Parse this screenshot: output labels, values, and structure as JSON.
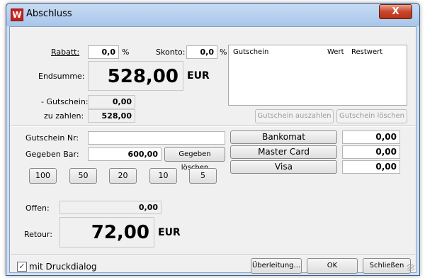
{
  "window": {
    "title": "Abschluss",
    "app_icon": "W",
    "close_glyph": "X"
  },
  "top": {
    "rabatt_label": "Rabatt:",
    "rabatt_value": "0,0",
    "rabatt_unit": "%",
    "skonto_label": "Skonto:",
    "skonto_value": "0,0",
    "skonto_unit": "%",
    "endsumme_label": "Endsumme:",
    "endsumme_value": "528,00",
    "endsumme_currency": "EUR",
    "gutschein_label": "- Gutschein:",
    "gutschein_value": "0,00",
    "zuzahlen_label": "zu zahlen:",
    "zuzahlen_value": "528,00"
  },
  "voucher_table": {
    "columns": [
      "Gutschein",
      "Wert",
      "Restwert"
    ],
    "rows": [],
    "btn_auszahlen": "Gutschein auszahlen",
    "btn_loeschen": "Gutschein löschen"
  },
  "payment": {
    "gutschein_nr_label": "Gutschein Nr:",
    "gutschein_nr_value": "",
    "gegeben_bar_label": "Gegeben Bar:",
    "gegeben_bar_value": "600,00",
    "gegeben_loeschen": "Gegeben löschen",
    "quick_amounts": [
      "100",
      "50",
      "20",
      "10",
      "5"
    ],
    "methods": [
      {
        "name": "Bankomat",
        "value": "0,00"
      },
      {
        "name": "Master Card",
        "value": "0,00"
      },
      {
        "name": "Visa",
        "value": "0,00"
      }
    ]
  },
  "result": {
    "offen_label": "Offen:",
    "offen_value": "0,00",
    "retour_label": "Retour:",
    "retour_value": "72,00",
    "retour_currency": "EUR"
  },
  "footer": {
    "mit_druckdialog_label": "mit Druckdialog",
    "mit_druckdialog_checked": true,
    "ueberleitung": "Überleitung...",
    "ok": "OK",
    "schliessen": "Schließen"
  }
}
